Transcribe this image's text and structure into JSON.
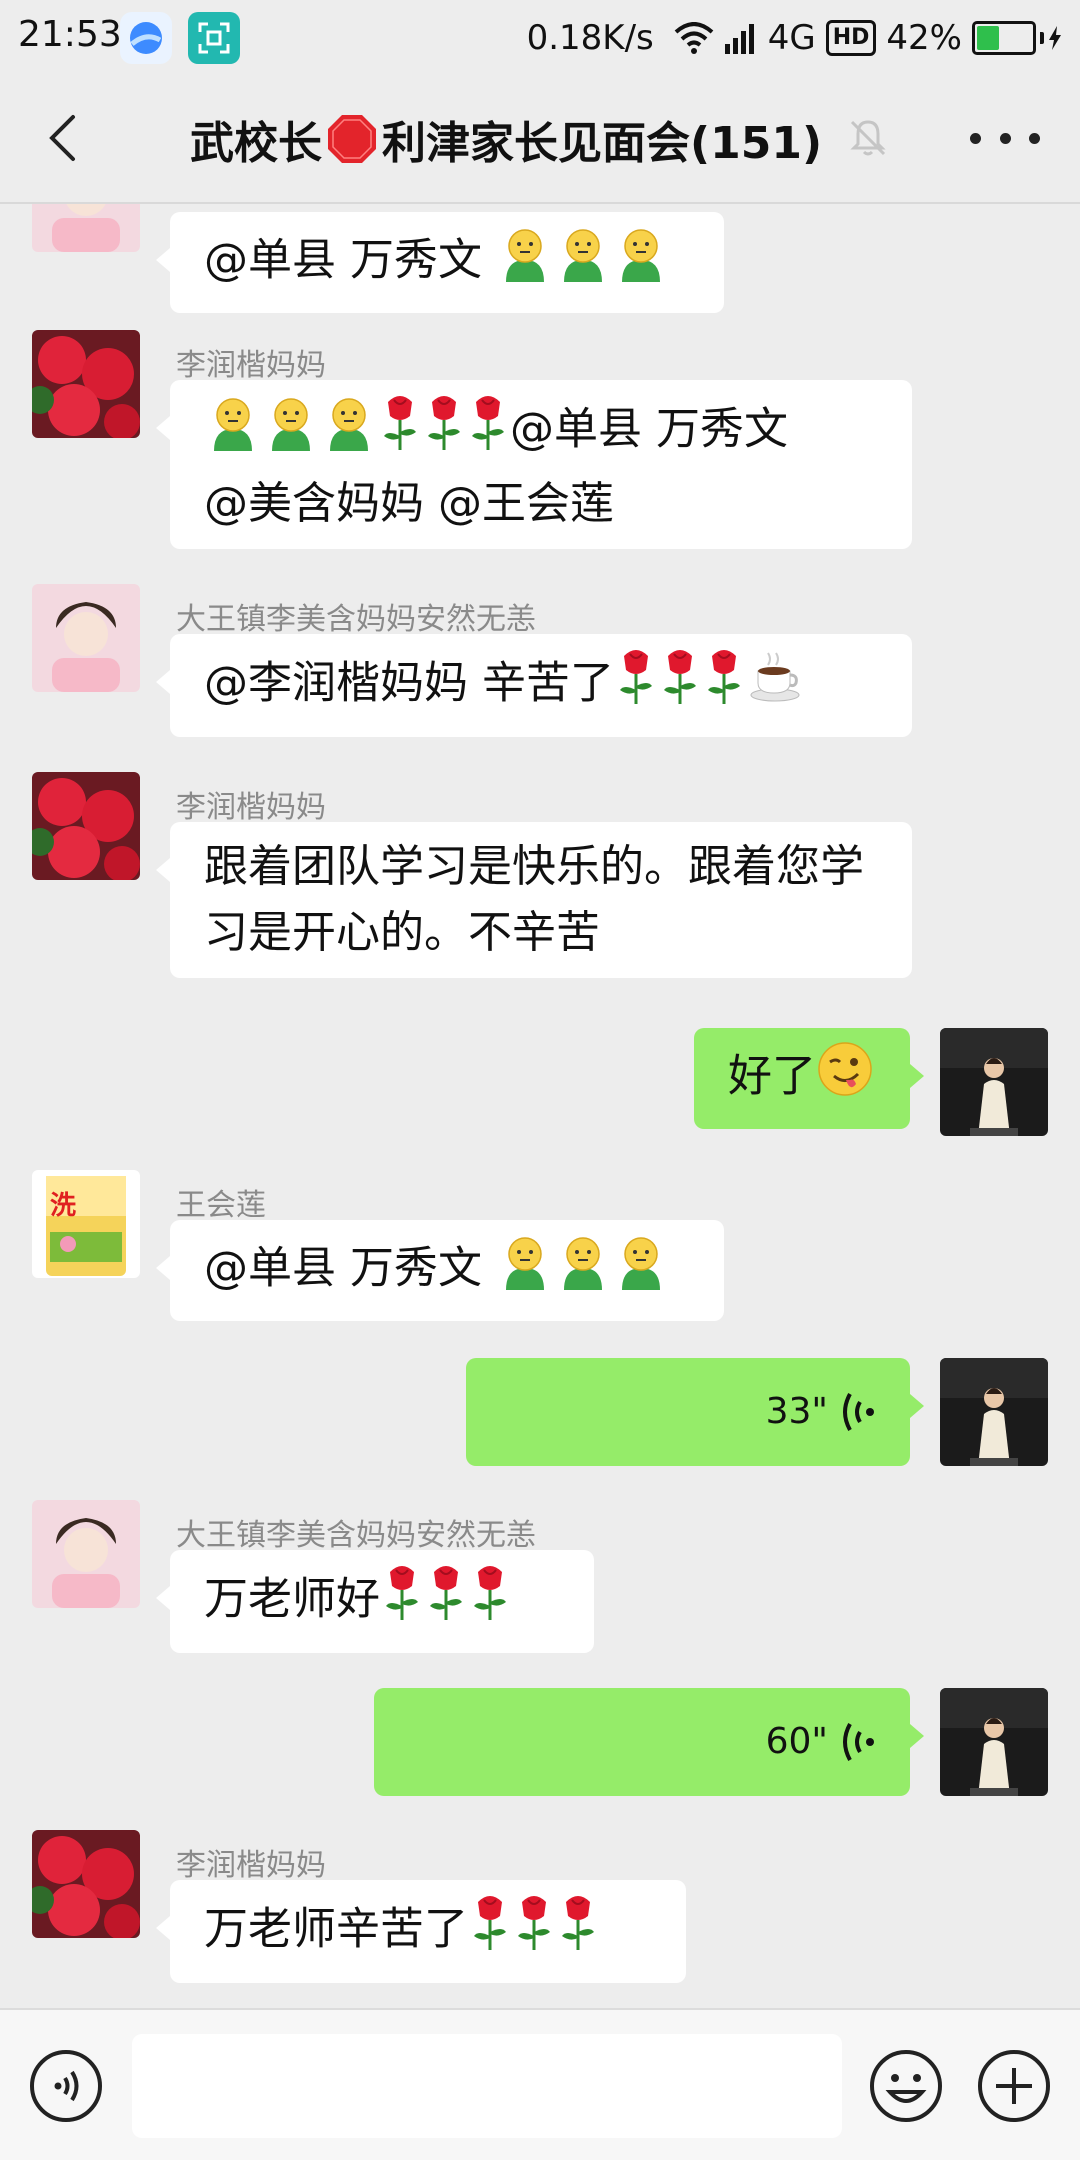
{
  "status_bar": {
    "time": "21:53",
    "net_speed": "0.18K/s",
    "network": "4G",
    "hd": "HD",
    "battery": "42%",
    "battery_level": 0.42
  },
  "header": {
    "title_before": "武校长",
    "title_after": " 利津家长见面会(151)"
  },
  "colors": {
    "background": "#ededed",
    "own_bubble": "#95ec69",
    "other_bubble": "#ffffff"
  },
  "messages": [
    {
      "sender": "",
      "text": "@单县  万秀文 "
    },
    {
      "sender": "李润楷妈妈",
      "line1_text": "@单县  万秀文",
      "line2": "@美含妈妈 @王会莲"
    },
    {
      "sender": "大王镇李美含妈妈安然无恙",
      "text": "@李润楷妈妈  辛苦了"
    },
    {
      "sender": "李润楷妈妈",
      "line1": "跟着团队学习是快乐的。跟着您学",
      "line2": "习是开心的。不辛苦"
    },
    {
      "sender": "",
      "text": "好了"
    },
    {
      "sender": "王会莲",
      "text": "@单县  万秀文 "
    },
    {
      "sender": "",
      "duration": "33\""
    },
    {
      "sender": "大王镇李美含妈妈安然无恙",
      "text": "万老师好"
    },
    {
      "sender": "",
      "duration": "60\""
    },
    {
      "sender": "李润楷妈妈",
      "text": "万老师辛苦了"
    }
  ],
  "icons": {
    "back": "chevron-left-icon",
    "mute": "bell-muted-icon",
    "more": "more-dots-icon",
    "voice": "voice-input-icon",
    "emoji": "smiley-icon",
    "plus": "plus-icon"
  }
}
